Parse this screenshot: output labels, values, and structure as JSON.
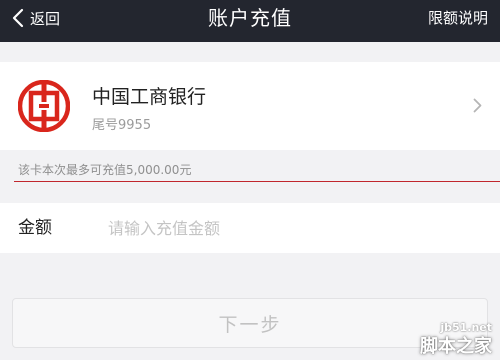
{
  "header": {
    "back_label": "返回",
    "title": "账户充值",
    "limit_link": "限额说明"
  },
  "bank": {
    "name": "中国工商银行",
    "tail": "尾号9955",
    "logo_icon": "icbc-logo-icon",
    "logo_color": "#d9261c"
  },
  "hint": {
    "text": "该卡本次最多可充值5,000.00元"
  },
  "amount": {
    "label": "金额",
    "placeholder": "请输入充值金额",
    "value": ""
  },
  "next_button": {
    "label": "下一步"
  },
  "watermark": {
    "url": "jb51.net",
    "name": "脚本之家"
  },
  "colors": {
    "topbar": "#23262f",
    "accent_line": "#c1272d",
    "background": "#f2f2f4"
  }
}
